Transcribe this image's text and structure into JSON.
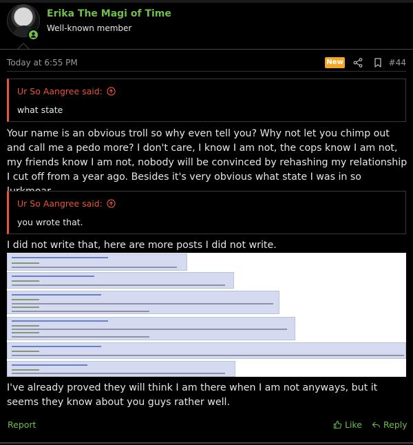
{
  "user": {
    "name": "Erika The Magi of Time",
    "title": "Well-known member",
    "avatar_icon": "avatar",
    "status_icon": "online-user-icon"
  },
  "post": {
    "timestamp": "Today at 6:55 PM",
    "new_badge": "New",
    "number": "#44",
    "quote1": {
      "author": "Ur So Aangree said:",
      "text": "what state"
    },
    "paragraph1": "Your name is an obvious troll so why even tell you? Why not let you chimp out and call me a pedo more? I don't care, I know I am not, the cops know I am not, my friends know I am not, nobody will be convinced by rehashing my relationship I cut off from a year ago. Besides it's very obvious what state I was in so lurkmoar.",
    "quote2": {
      "author": "Ur So Aangree said:",
      "text": "you wrote that."
    },
    "paragraph2": "I did not write that, here are more posts I did not write.",
    "paragraph3": "I've already proved they will think I am there when I am not anyways, but it seems they know about you guys rather well."
  },
  "actions": {
    "report": "Report",
    "like": "Like",
    "reply": "Reply"
  },
  "colors": {
    "accent_green": "#6fbf4a",
    "quote_red": "#e8553a",
    "new_badge": "#f5a623"
  }
}
